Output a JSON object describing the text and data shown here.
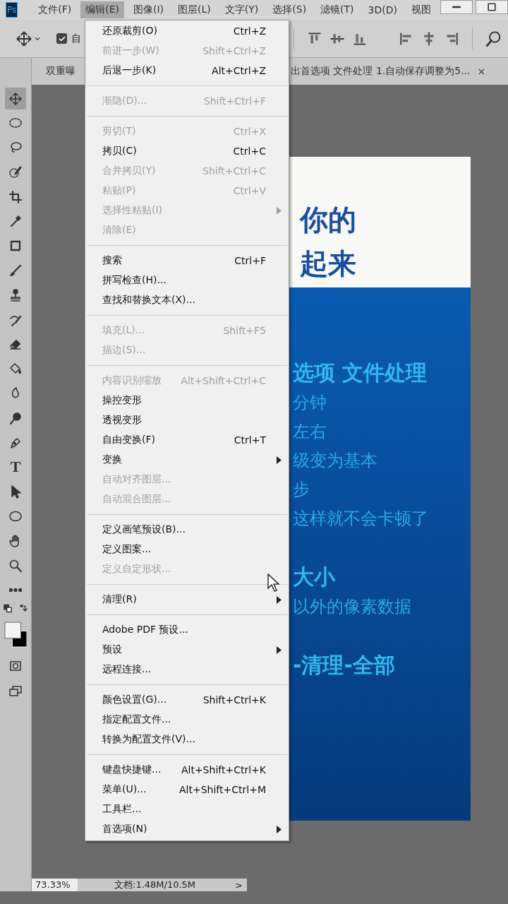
{
  "menubar": {
    "logo": "Ps",
    "menus": [
      {
        "label": "文件(F)",
        "selected": false
      },
      {
        "label": "编辑(E)",
        "selected": true
      },
      {
        "label": "图像(I)",
        "selected": false
      },
      {
        "label": "图层(L)",
        "selected": false
      },
      {
        "label": "文字(Y)",
        "selected": false
      },
      {
        "label": "选择(S)",
        "selected": false
      },
      {
        "label": "滤镜(T)",
        "selected": false
      },
      {
        "label": "3D(D)",
        "selected": false
      },
      {
        "label": "视图",
        "selected": false
      }
    ]
  },
  "options_bar": {
    "auto_select": {
      "label": "自",
      "checked": true
    }
  },
  "document_tab": {
    "title_start": "双重曝",
    "title_end": "出首选项 文件处理 1.自动保存调整为5...",
    "close": "×"
  },
  "toolbar": {
    "tools": [
      {
        "kind": "move",
        "selected": true
      },
      {
        "kind": "marquee",
        "selected": false
      },
      {
        "kind": "lasso",
        "selected": false
      },
      {
        "kind": "quick-select",
        "selected": false
      },
      {
        "kind": "crop",
        "selected": false
      },
      {
        "kind": "eyedropper",
        "selected": false
      },
      {
        "kind": "frame",
        "selected": false
      },
      {
        "kind": "brush",
        "selected": false
      },
      {
        "kind": "stamp",
        "selected": false
      },
      {
        "kind": "history-brush",
        "selected": false
      },
      {
        "kind": "eraser",
        "selected": false
      },
      {
        "kind": "bucket",
        "selected": false
      },
      {
        "kind": "blur",
        "selected": false
      },
      {
        "kind": "dodge",
        "selected": false
      },
      {
        "kind": "pen",
        "selected": false
      },
      {
        "kind": "type",
        "glyph": "T",
        "selected": false
      },
      {
        "kind": "path-select",
        "selected": false
      },
      {
        "kind": "ellipse",
        "selected": false
      },
      {
        "kind": "hand",
        "selected": false
      },
      {
        "kind": "zoom",
        "selected": false
      },
      {
        "kind": "more",
        "selected": false
      }
    ]
  },
  "poster": {
    "header_lines": [
      "你的",
      "起来"
    ],
    "body_lines": [
      {
        "kind": "heading",
        "text": "选项 文件处理"
      },
      {
        "kind": "body",
        "text": "分钟"
      },
      {
        "kind": "body",
        "text": "左右"
      },
      {
        "kind": "body",
        "text": "级变为基本"
      },
      {
        "kind": "body",
        "text": "步"
      },
      {
        "kind": "body",
        "text": "这样就不会卡顿了"
      },
      {
        "kind": "heading",
        "text": "大小"
      },
      {
        "kind": "body",
        "text": "以外的像素数据"
      },
      {
        "kind": "heading",
        "text": "-清理-全部"
      }
    ]
  },
  "edit_menu": {
    "groups": [
      [
        {
          "label": "还原裁剪(O)",
          "shortcut": "Ctrl+Z",
          "disabled": false
        },
        {
          "label": "前进一步(W)",
          "shortcut": "Shift+Ctrl+Z",
          "disabled": true
        },
        {
          "label": "后退一步(K)",
          "shortcut": "Alt+Ctrl+Z",
          "disabled": false
        }
      ],
      [
        {
          "label": "渐隐(D)...",
          "shortcut": "Shift+Ctrl+F",
          "disabled": true
        }
      ],
      [
        {
          "label": "剪切(T)",
          "shortcut": "Ctrl+X",
          "disabled": true
        },
        {
          "label": "拷贝(C)",
          "shortcut": "Ctrl+C",
          "disabled": false
        },
        {
          "label": "合并拷贝(Y)",
          "shortcut": "Shift+Ctrl+C",
          "disabled": true
        },
        {
          "label": "粘贴(P)",
          "shortcut": "Ctrl+V",
          "disabled": true
        },
        {
          "label": "选择性粘贴(I)",
          "submenu": true,
          "disabled": true
        },
        {
          "label": "清除(E)",
          "disabled": true
        }
      ],
      [
        {
          "label": "搜索",
          "shortcut": "Ctrl+F",
          "disabled": false
        },
        {
          "label": "拼写检查(H)...",
          "disabled": false
        },
        {
          "label": "查找和替换文本(X)...",
          "disabled": false
        }
      ],
      [
        {
          "label": "填充(L)...",
          "shortcut": "Shift+F5",
          "disabled": true
        },
        {
          "label": "描边(S)...",
          "disabled": true
        }
      ],
      [
        {
          "label": "内容识别缩放",
          "shortcut": "Alt+Shift+Ctrl+C",
          "disabled": true
        },
        {
          "label": "操控变形",
          "disabled": false
        },
        {
          "label": "透视变形",
          "disabled": false
        },
        {
          "label": "自由变换(F)",
          "shortcut": "Ctrl+T",
          "disabled": false
        },
        {
          "label": "变换",
          "submenu": true,
          "disabled": false
        },
        {
          "label": "自动对齐图层...",
          "disabled": true
        },
        {
          "label": "自动混合图层...",
          "disabled": true
        }
      ],
      [
        {
          "label": "定义画笔预设(B)...",
          "disabled": false
        },
        {
          "label": "定义图案...",
          "disabled": false
        },
        {
          "label": "定义自定形状...",
          "disabled": true
        }
      ],
      [
        {
          "label": "清理(R)",
          "submenu": true,
          "disabled": false
        }
      ],
      [
        {
          "label": "Adobe PDF 预设...",
          "disabled": false
        },
        {
          "label": "预设",
          "submenu": true,
          "disabled": false
        },
        {
          "label": "远程连接...",
          "disabled": false
        }
      ],
      [
        {
          "label": "颜色设置(G)...",
          "shortcut": "Shift+Ctrl+K",
          "disabled": false
        },
        {
          "label": "指定配置文件...",
          "disabled": false
        },
        {
          "label": "转换为配置文件(V)...",
          "disabled": false
        }
      ],
      [
        {
          "label": "键盘快捷键...",
          "shortcut": "Alt+Shift+Ctrl+K",
          "disabled": false
        },
        {
          "label": "菜单(U)...",
          "shortcut": "Alt+Shift+Ctrl+M",
          "disabled": false
        },
        {
          "label": "工具栏...",
          "disabled": false
        },
        {
          "label": "首选项(N)",
          "submenu": true,
          "disabled": false
        }
      ]
    ]
  },
  "status_bar": {
    "zoom": "73.33%",
    "doc_size": "文档:1.48M/10.5M",
    "arrow": ">"
  }
}
